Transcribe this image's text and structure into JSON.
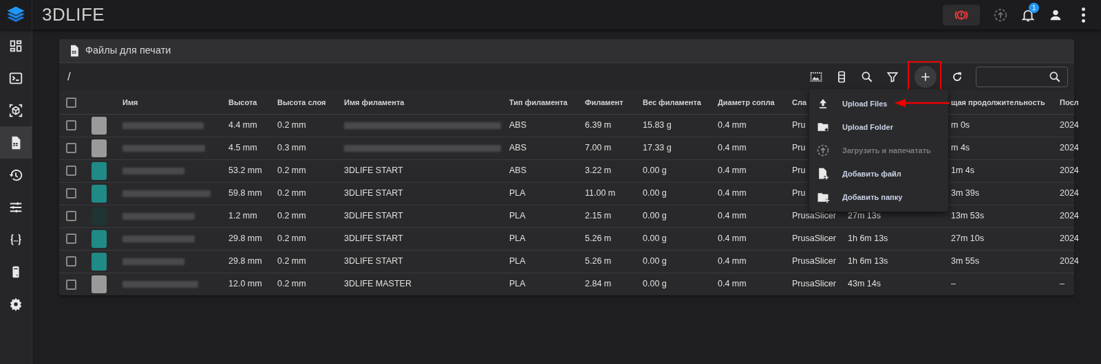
{
  "app": {
    "title": "3DLIFE",
    "notifications": "1"
  },
  "topbar_buttons": [
    {
      "kind": "estop",
      "disabled": false
    },
    {
      "kind": "printupload",
      "disabled": true
    },
    {
      "kind": "bell",
      "disabled": false
    },
    {
      "kind": "user",
      "disabled": false
    },
    {
      "kind": "more",
      "disabled": false
    }
  ],
  "sidebar": {
    "items": [
      {
        "kind": "dashboard",
        "selected": false
      },
      {
        "kind": "console",
        "selected": false
      },
      {
        "kind": "object",
        "selected": false
      },
      {
        "kind": "files",
        "selected": true
      },
      {
        "kind": "history",
        "selected": false
      },
      {
        "kind": "tune",
        "selected": false
      },
      {
        "kind": "macros",
        "selected": false
      },
      {
        "kind": "machine",
        "selected": false
      },
      {
        "kind": "settings",
        "selected": false
      }
    ]
  },
  "card": {
    "title": "Файлы для печати",
    "path": "/",
    "toolbar": [
      {
        "kind": "thumbs",
        "active": false,
        "highlighted": false
      },
      {
        "kind": "columns",
        "active": false,
        "highlighted": false
      },
      {
        "kind": "search",
        "active": false,
        "highlighted": false
      },
      {
        "kind": "filter",
        "active": false,
        "highlighted": false
      },
      {
        "kind": "add",
        "active": true,
        "highlighted": true
      },
      {
        "kind": "refresh",
        "active": false,
        "highlighted": false
      }
    ]
  },
  "table": {
    "all_checked": false,
    "columns": [
      "Имя",
      "Высота",
      "Высота слоя",
      "Имя филамента",
      "Тип филамента",
      "Филамент",
      "Вес филамента",
      "Диаметр сопла",
      "Сла",
      null,
      "щая продолжительность",
      "Посл"
    ],
    "rows": [
      {
        "checked": false,
        "color": "#9a9a9a",
        "height": "4.4 mm",
        "layer_height": "0.2 mm",
        "filament_blurred": true,
        "filament_type": "ABS",
        "filament": "6.39 m",
        "filament_weight": "15.83 g",
        "nozzle": "0.4 mm",
        "slicer": "Pru",
        "total_time": "m 0s",
        "last": "2024"
      },
      {
        "checked": false,
        "color": "#9a9a9a",
        "height": "4.5 mm",
        "layer_height": "0.3 mm",
        "filament_blurred": true,
        "filament_type": "ABS",
        "filament": "7.00 m",
        "filament_weight": "17.33 g",
        "nozzle": "0.4 mm",
        "slicer": "Pru",
        "total_time": "m 4s",
        "last": "2024"
      },
      {
        "checked": false,
        "color": "#1f8a86",
        "height": "53.2 mm",
        "layer_height": "0.2 mm",
        "filament_name": "3DLIFE START",
        "filament_type": "ABS",
        "filament": "3.22 m",
        "filament_weight": "0.00 g",
        "nozzle": "0.4 mm",
        "slicer": "Pru",
        "total_time": "1m 4s",
        "last": "2024"
      },
      {
        "checked": false,
        "color": "#1f8a86",
        "height": "59.8 mm",
        "layer_height": "0.2 mm",
        "filament_name": "3DLIFE START",
        "filament_type": "PLA",
        "filament": "11.00 m",
        "filament_weight": "0.00 g",
        "nozzle": "0.4 mm",
        "slicer": "Pru",
        "total_time": "3m 39s",
        "last": "2024"
      },
      {
        "checked": false,
        "color": "#1f3433",
        "height": "1.2 mm",
        "layer_height": "0.2 mm",
        "filament_name": "3DLIFE START",
        "filament_type": "PLA",
        "filament": "2.15 m",
        "filament_weight": "0.00 g",
        "nozzle": "0.4 mm",
        "slicer": "PrusaSlicer",
        "print_time": "27m 13s",
        "total_time": "13m 53s",
        "last": "2024"
      },
      {
        "checked": false,
        "color": "#1f8a86",
        "height": "29.8 mm",
        "layer_height": "0.2 mm",
        "filament_name": "3DLIFE START",
        "filament_type": "PLA",
        "filament": "5.26 m",
        "filament_weight": "0.00 g",
        "nozzle": "0.4 mm",
        "slicer": "PrusaSlicer",
        "print_time": "1h 6m 13s",
        "total_time": "27m 10s",
        "last": "2024"
      },
      {
        "checked": false,
        "color": "#1f8a86",
        "height": "29.8 mm",
        "layer_height": "0.2 mm",
        "filament_name": "3DLIFE START",
        "filament_type": "PLA",
        "filament": "5.26 m",
        "filament_weight": "0.00 g",
        "nozzle": "0.4 mm",
        "slicer": "PrusaSlicer",
        "print_time": "1h 6m 13s",
        "total_time": "3m 55s",
        "last": "2024"
      },
      {
        "checked": false,
        "color": "#9a9a9a",
        "height": "12.0 mm",
        "layer_height": "0.2 mm",
        "filament_name": "3DLIFE MASTER",
        "filament_type": "PLA",
        "filament": "2.84 m",
        "filament_weight": "0.00 g",
        "nozzle": "0.4 mm",
        "slicer": "PrusaSlicer",
        "print_time": "43m 14s",
        "total_time": "–",
        "last": "–"
      }
    ]
  },
  "add_menu": {
    "items": [
      {
        "kind": "upload",
        "label": "Upload Files",
        "disabled": false,
        "pointed": true
      },
      {
        "kind": "folderupload",
        "label": "Upload Folder",
        "disabled": false,
        "pointed": false
      },
      {
        "kind": "printupload",
        "label": "Загрузить и напечатать",
        "disabled": true,
        "pointed": false
      },
      {
        "kind": "newfile",
        "label": "Добавить файл",
        "disabled": false,
        "pointed": false
      },
      {
        "kind": "newfolder",
        "label": "Добавить папку",
        "disabled": false,
        "pointed": false
      }
    ]
  }
}
